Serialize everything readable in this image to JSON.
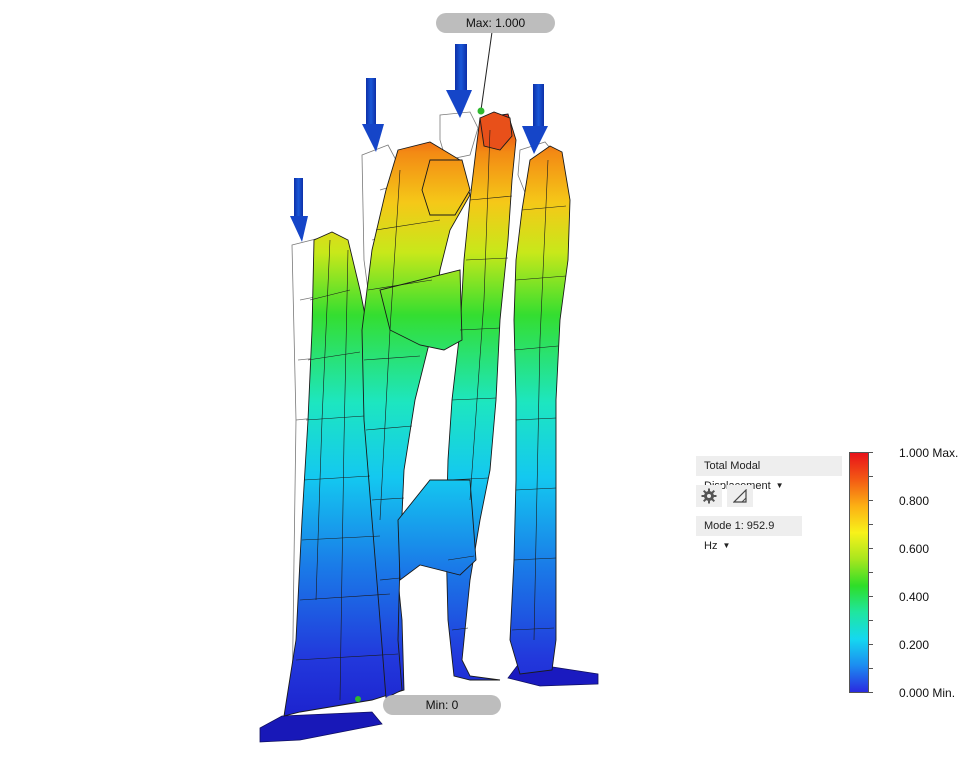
{
  "callouts": {
    "max": "Max: 1.000",
    "min": "Min: 0"
  },
  "result_panel": {
    "result_type": "Total Modal Displacement",
    "mode": "Mode 1: 952.9 Hz",
    "tools": [
      {
        "icon": "gear-icon"
      },
      {
        "icon": "deformation-triangle-icon"
      }
    ]
  },
  "legend": {
    "labels": [
      "1.000 Max.",
      "0.800",
      "0.600",
      "0.400",
      "0.200",
      "0.000 Min."
    ],
    "colors": [
      "#e8121a",
      "#f35a14",
      "#fcb014",
      "#f8f21a",
      "#a8e61e",
      "#2ede28",
      "#1fe6a0",
      "#15d8f0",
      "#1c8cf0",
      "#2a2ae0"
    ]
  },
  "model": {
    "load_arrow_color": "#1545c8",
    "probe_marker_color": "#2eb82e"
  }
}
